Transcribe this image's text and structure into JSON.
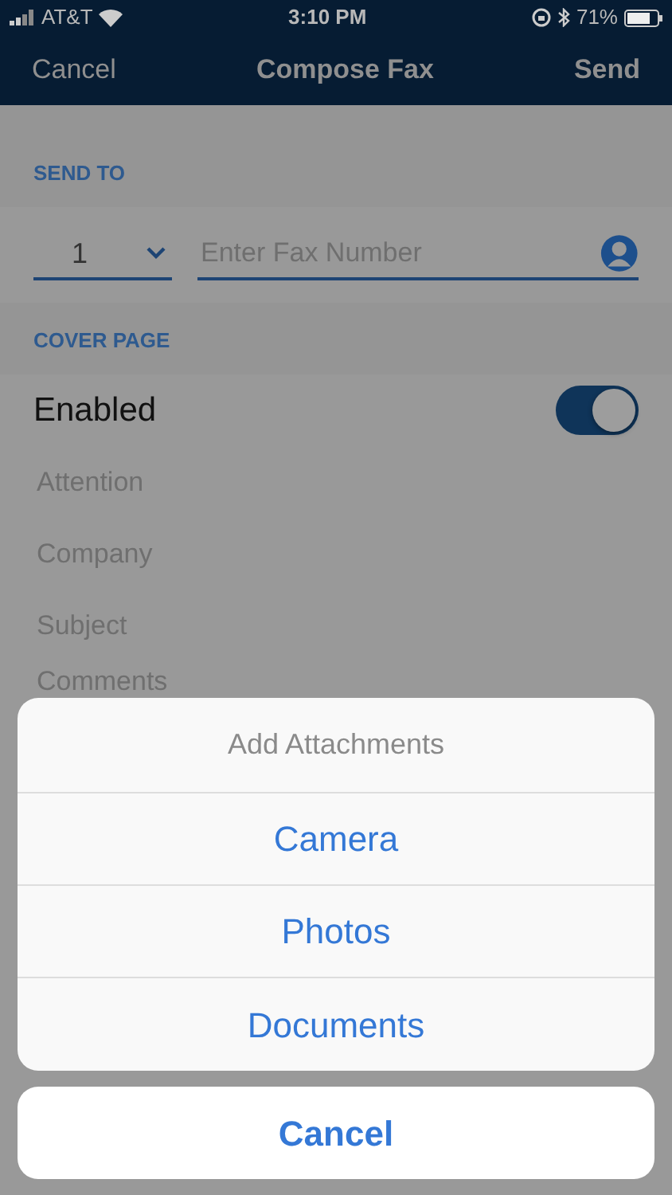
{
  "status_bar": {
    "carrier": "AT&T",
    "time": "3:10 PM",
    "battery": "71%"
  },
  "nav": {
    "left": "Cancel",
    "title": "Compose Fax",
    "right": "Send"
  },
  "send_to": {
    "header": "SEND TO",
    "country_code": "1",
    "fax_placeholder": "Enter Fax Number"
  },
  "cover_page": {
    "header": "COVER PAGE",
    "enabled_label": "Enabled",
    "enabled_on": true,
    "fields": [
      {
        "placeholder": "Attention"
      },
      {
        "placeholder": "Company"
      },
      {
        "placeholder": "Subject"
      },
      {
        "placeholder": "Comments"
      }
    ]
  },
  "action_sheet": {
    "title": "Add Attachments",
    "actions": [
      "Camera",
      "Photos",
      "Documents"
    ],
    "cancel": "Cancel"
  }
}
